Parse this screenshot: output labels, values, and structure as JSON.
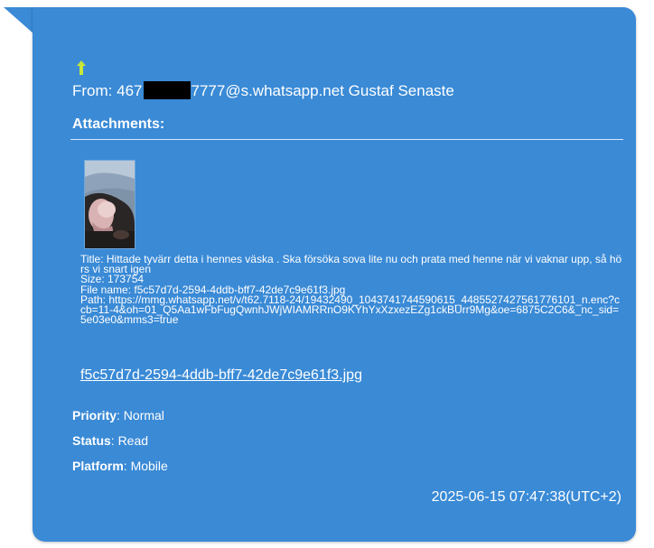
{
  "message": {
    "from_label": "From:",
    "from_prefix": "467",
    "from_suffix": "7777@s.whatsapp.net Gustaf Senaste",
    "attachments_heading": "Attachments:",
    "attachment": {
      "title": "Title: Hittade tyvärr detta i hennes väska . Ska försöka sova lite nu och prata med henne när vi vaknar upp, så hörs vi snart igen",
      "size": "Size: 173754",
      "file_name": "File name: f5c57d7d-2594-4ddb-bff7-42de7c9e61f3.jpg",
      "path": "Path: https://mmg.whatsapp.net/v/t62.7118-24/19432490_1043741744590615_4485527427561776101_n.enc?ccb=11-4&oh=01_Q5Aa1wFbFugQwnhJWjWIAMRRnO9KYhYxXzxezEZg1ckBUrr9Mg&oe=6875C2C6&_nc_sid=5e03e0&mms3=true",
      "link_text": "f5c57d7d-2594-4ddb-bff7-42de7c9e61f3.jpg"
    },
    "priority_label": "Priority",
    "priority_value": ": Normal",
    "status_label": "Status",
    "status_value": ": Read",
    "platform_label": "Platform",
    "platform_value": ": Mobile",
    "timestamp": "2025-06-15 07:47:38(UTC+2)"
  },
  "icons": {
    "direction": "up-arrow-icon",
    "direction_color": "#c8e63a"
  },
  "colors": {
    "bubble": "#3a8ad6",
    "text": "#ffffff"
  }
}
